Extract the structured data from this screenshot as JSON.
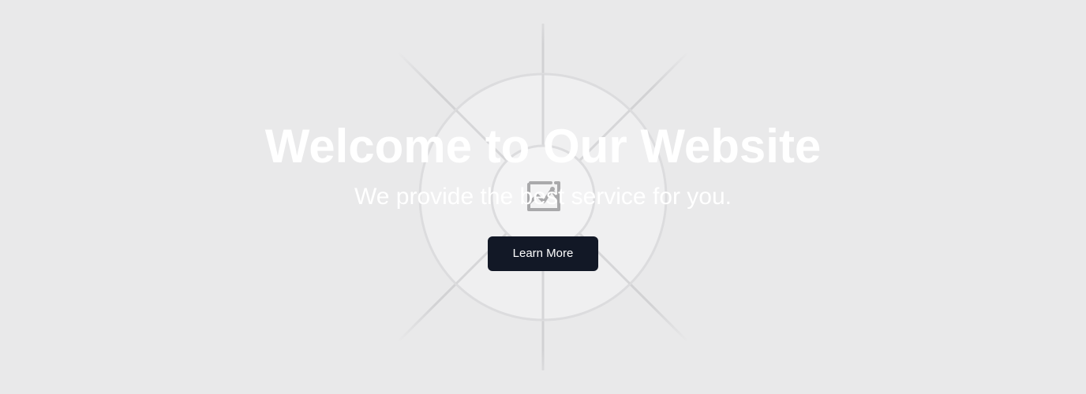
{
  "hero": {
    "title": "Welcome to Our Website",
    "subtitle": "We provide the best service for you.",
    "cta_label": "Learn More",
    "background_image_icon": "image-placeholder-icon"
  },
  "colors": {
    "background": "#e9e9ea",
    "text": "#ffffff",
    "button_background": "#121826",
    "button_text": "#ffffff",
    "placeholder_lines": "#d4d4d6",
    "placeholder_circle_fill": "#efefef",
    "placeholder_icon": "#a9a9ab"
  }
}
